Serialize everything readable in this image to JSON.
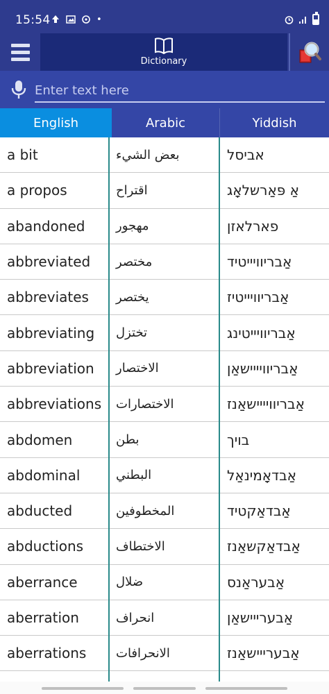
{
  "status_bar": {
    "time": "15:54",
    "dot": "•"
  },
  "toolbar": {
    "title": "Dictionary"
  },
  "input": {
    "placeholder": "Enter text here",
    "value": ""
  },
  "tabs": [
    {
      "label": "English",
      "active": true
    },
    {
      "label": "Arabic",
      "active": false
    },
    {
      "label": "Yiddish",
      "active": false
    }
  ],
  "rows": [
    {
      "en": "a bit",
      "ar": "بعض الشيء",
      "yi": "אביסל"
    },
    {
      "en": "a propos",
      "ar": "اقتراح",
      "yi": "אַ פּאַרשלאָג"
    },
    {
      "en": "abandoned",
      "ar": "مهجور",
      "yi": "פארלאזן"
    },
    {
      "en": "abbreviated",
      "ar": "مختصر",
      "yi": "אַבריוויייטיד"
    },
    {
      "en": "abbreviates",
      "ar": "يختصر",
      "yi": "אַבריוויייטיז"
    },
    {
      "en": "abbreviating",
      "ar": "تختزل",
      "yi": "אַבריוויייטינג"
    },
    {
      "en": "abbreviation",
      "ar": "الاختصار",
      "yi": "אַבריוויייישאַן"
    },
    {
      "en": "abbreviations",
      "ar": "الاختصارات",
      "yi": "אַבריוויייישאַנז"
    },
    {
      "en": "abdomen",
      "ar": "بطن",
      "yi": "בויך"
    },
    {
      "en": "abdominal",
      "ar": "البطني",
      "yi": "אַבדאָמינאַל"
    },
    {
      "en": "abducted",
      "ar": "المخطوفين",
      "yi": "אַבדאַקטיד"
    },
    {
      "en": "abductions",
      "ar": "الاختطاف",
      "yi": "אַבדאַקשאַנז"
    },
    {
      "en": "aberrance",
      "ar": "ضلال",
      "yi": "אַבעראַנס"
    },
    {
      "en": "aberration",
      "ar": "انحراف",
      "yi": "אַבערייישאַן"
    },
    {
      "en": "aberrations",
      "ar": "الانحرافات",
      "yi": "אַבערייישאַנז"
    },
    {
      "en": "",
      "ar": "",
      "yi": ""
    }
  ],
  "colors": {
    "header": "#2e3b8e",
    "dictionary_tab": "#1b2a78",
    "input_bar": "#3446a6",
    "active_tab": "#0a8ee0",
    "column_divider": "#2a8a8a"
  },
  "icons": {
    "menu": "menu-list-icon",
    "dictionary": "open-book-icon",
    "search": "magnifier-book-icon",
    "mic": "microphone-icon"
  }
}
